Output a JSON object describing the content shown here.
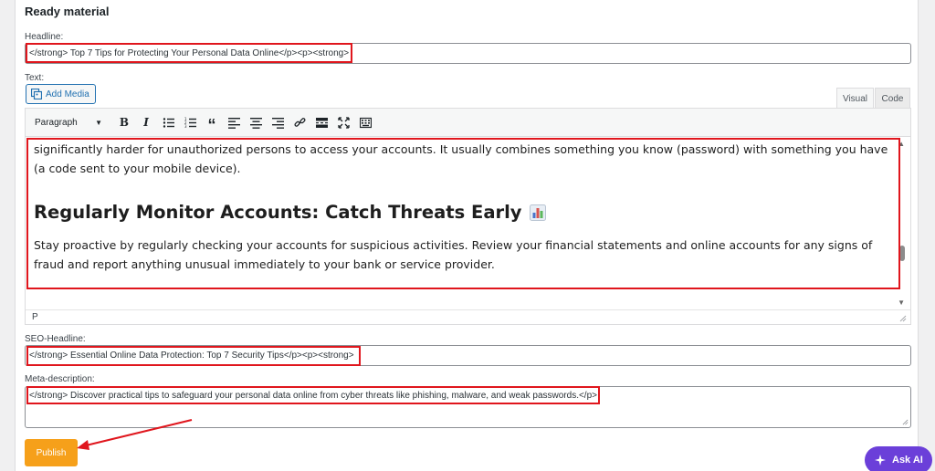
{
  "section": {
    "title": "Ready material"
  },
  "headline": {
    "label": "Headline:",
    "value": "</strong> Top 7 Tips for Protecting Your Personal Data Online</p><p><strong>"
  },
  "text": {
    "label": "Text:",
    "add_media_label": "Add Media",
    "tabs": [
      {
        "label": "Visual",
        "active": true
      },
      {
        "label": "Code",
        "active": false
      }
    ],
    "format_select": "Paragraph",
    "content": {
      "paragraph_1": "significantly harder for unauthorized persons to access your accounts. It usually combines something you know (password) with something you have (a code sent to your mobile device).",
      "heading": "Regularly Monitor Accounts: Catch Threats Early",
      "heading_icon": "bar-chart-emoji",
      "paragraph_2": "Stay proactive by regularly checking your accounts for suspicious activities. Review your financial statements and online accounts for any signs of fraud and report anything unusual immediately to your bank or service provider."
    },
    "status_path": "P"
  },
  "seo_headline": {
    "label": "SEO-Headline:",
    "value": "</strong> Essential Online Data Protection: Top 7 Security Tips</p><p><strong>"
  },
  "meta_description": {
    "label": "Meta-description:",
    "value": "</strong> Discover practical tips to safeguard your personal data online from cyber threats like phishing, malware, and weak passwords.</p>"
  },
  "publish_label": "Publish",
  "ask_ai_label": "Ask AI",
  "colors": {
    "highlight_red": "#e0161d",
    "publish_orange": "#f6a01a",
    "ask_ai_purple": "#6b3fd9",
    "wp_blue": "#2271b1"
  }
}
